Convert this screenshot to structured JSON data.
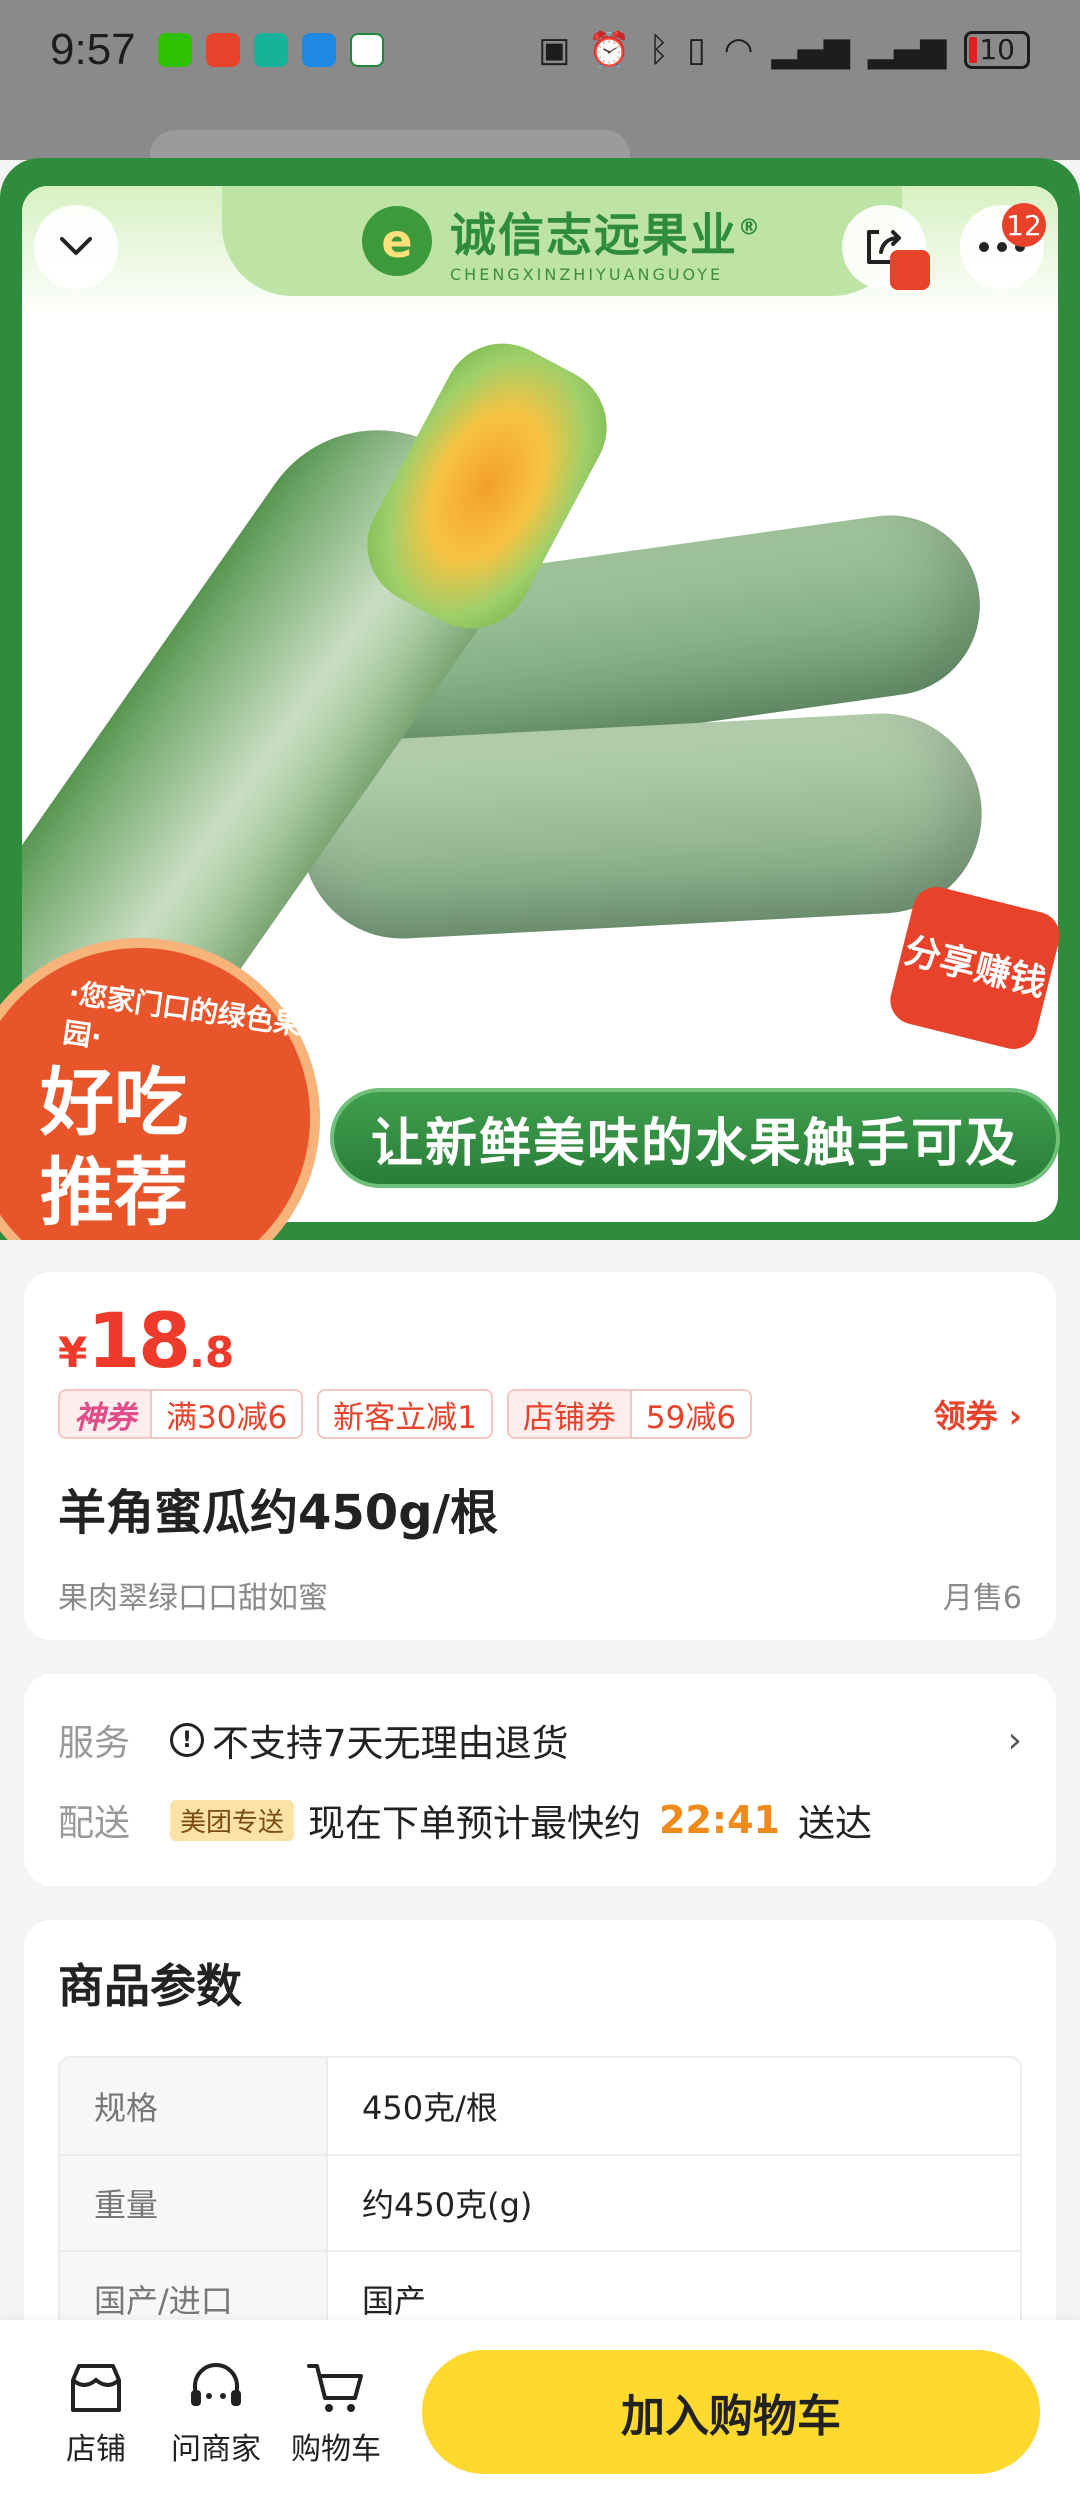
{
  "status_bar": {
    "time": "9:57",
    "battery": "10",
    "app_icons": [
      "wechat-icon",
      "app-red-icon",
      "app-green-icon",
      "app-blue-icon",
      "app-post-icon"
    ],
    "right_icons": [
      "nfc-icon",
      "alarm-icon",
      "bluetooth-icon",
      "vibrate-icon",
      "wifi-icon",
      "signal-icon",
      "signal-icon-2"
    ]
  },
  "hero": {
    "brand_cn": "诚信志远果业",
    "brand_en": "CHENGXINZHIYUANGUOYE",
    "registered_mark": "®",
    "badge_line1": "好吃",
    "badge_line2": "推荐",
    "badge_ring": "·您家门口的绿色果园·",
    "slogan": "让新鲜美味的水果触手可及",
    "share_earn": "分享赚钱",
    "notification_count": "12"
  },
  "price": {
    "symbol": "¥",
    "integer": "18",
    "decimal": ".8",
    "color": "#ee3a2a"
  },
  "coupons": [
    {
      "head": "神券",
      "body": "满30减6"
    },
    {
      "body": "新客立减1"
    },
    {
      "head": "店铺券",
      "body": "59减6"
    }
  ],
  "get_coupon_label": "领券 ›",
  "product": {
    "title": "羊角蜜瓜约450g/根",
    "subtitle": "果肉翠绿口口甜如蜜",
    "monthly_sales": "月售6"
  },
  "service": {
    "service_label": "服务",
    "service_icon": "warning-circle-icon",
    "service_text": "不支持7天无理由退货",
    "delivery_label": "配送",
    "delivery_tag": "美团专送",
    "delivery_prefix": "现在下单预计最快约",
    "delivery_time": "22:41",
    "delivery_suffix": "送达"
  },
  "params": {
    "title": "商品参数",
    "rows": [
      {
        "k": "规格",
        "v": "450克/根"
      },
      {
        "k": "重量",
        "v": "约450克(g)"
      },
      {
        "k": "国产/进口",
        "v": "国产"
      }
    ]
  },
  "bottom_bar": {
    "store": "店铺",
    "ask": "问商家",
    "cart": "购物车",
    "add_to_cart": "加入购物车",
    "accent": "#ffd92e"
  }
}
